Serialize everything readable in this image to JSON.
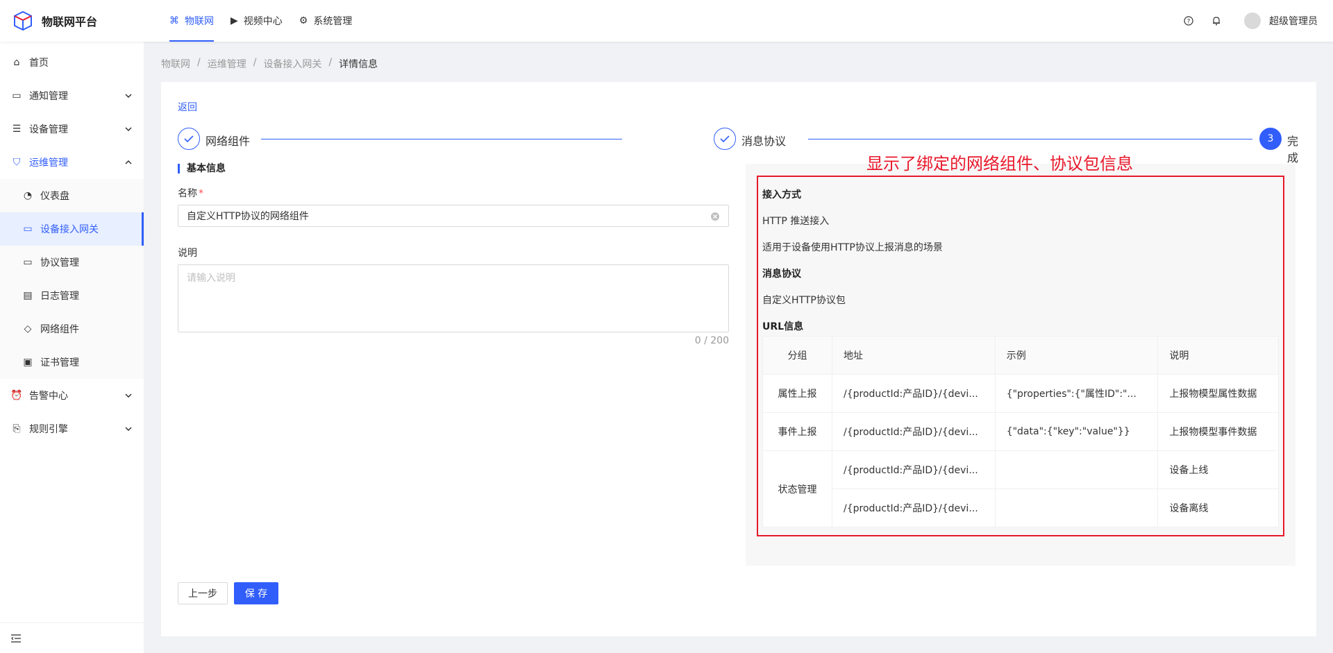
{
  "app": {
    "title": "物联网平台"
  },
  "topnav": [
    {
      "label": "物联网",
      "icon": "iot-icon"
    },
    {
      "label": "视频中心",
      "icon": "video-icon"
    },
    {
      "label": "系统管理",
      "icon": "system-icon"
    }
  ],
  "user": {
    "name": "超级管理员"
  },
  "sidebar": {
    "home": "首页",
    "notice": "通知管理",
    "device": "设备管理",
    "ops": "运维管理",
    "ops_children": [
      "仪表盘",
      "设备接入网关",
      "协议管理",
      "日志管理",
      "网络组件",
      "证书管理"
    ],
    "alarm": "告警中心",
    "rules": "规则引擎"
  },
  "breadcrumb": [
    "物联网",
    "运维管理",
    "设备接入网关",
    "详情信息"
  ],
  "page": {
    "back": "返回",
    "steps": [
      {
        "label": "网络组件",
        "status": "done"
      },
      {
        "label": "消息协议",
        "status": "done"
      },
      {
        "label": "完成",
        "number": "3",
        "status": "current"
      }
    ],
    "section_title": "基本信息",
    "name_label": "名称",
    "name_value": "自定义HTTP协议的网络组件",
    "desc_label": "说明",
    "desc_placeholder": "请输入说明",
    "desc_counter": "0 / 200"
  },
  "annotation": "显示了绑定的网络组件、协议包信息",
  "info": {
    "access_heading": "接入方式",
    "access_type": "HTTP 推送接入",
    "access_desc": "适用于设备使用HTTP协议上报消息的场景",
    "protocol_heading": "消息协议",
    "protocol_value": "自定义HTTP协议包",
    "url_heading": "URL信息"
  },
  "url_table": {
    "headers": [
      "分组",
      "地址",
      "示例",
      "说明"
    ],
    "rows": [
      {
        "group": "属性上报",
        "address": "/{productId:产品ID}/{devi...",
        "example": "{\"properties\":{\"属性ID\":\"...",
        "desc": "上报物模型属性数据"
      },
      {
        "group": "事件上报",
        "address": "/{productId:产品ID}/{devi...",
        "example": "{\"data\":{\"key\":\"value\"}}",
        "desc": "上报物模型事件数据"
      },
      {
        "group": "状态管理",
        "address": "/{productId:产品ID}/{devi...",
        "example": "",
        "desc": "设备上线"
      },
      {
        "group": "",
        "address": "/{productId:产品ID}/{devi...",
        "example": "",
        "desc": "设备离线"
      }
    ]
  },
  "buttons": {
    "prev": "上一步",
    "save": "保 存"
  },
  "colors": {
    "primary": "#315efb",
    "annotation": "#e8182b"
  }
}
